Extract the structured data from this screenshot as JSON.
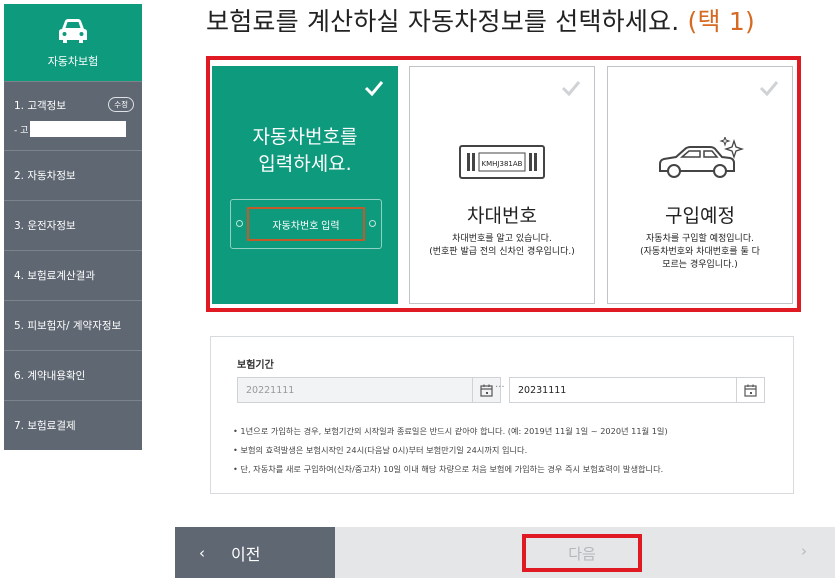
{
  "sidebar": {
    "head_label": "자동차보험",
    "items": [
      {
        "label": "1. 고객정보",
        "badge": "수정",
        "sub_prefix": "- 고"
      },
      {
        "label": "2. 자동차정보"
      },
      {
        "label": "3. 운전자정보"
      },
      {
        "label": "4. 보험료계산결과"
      },
      {
        "label": "5. 피보험자/ 계약자정보"
      },
      {
        "label": "6. 계약내용확인"
      },
      {
        "label": "7. 보험료결제"
      }
    ]
  },
  "main": {
    "title": "보험료를 계산하실 자동차정보를 선택하세요.",
    "title_hint": "(택 1)",
    "cards": [
      {
        "line1": "자동차번호를",
        "line2": "입력하세요.",
        "button": "자동차번호 입력"
      },
      {
        "plate": "KMHJ381AB",
        "name": "차대번호",
        "desc1": "차대번호를 알고 있습니다.",
        "desc2": "(번호판 발급 전의 신차인 경우입니다.)"
      },
      {
        "name": "구입예정",
        "desc1": "자동차를 구입할 예정입니다.",
        "desc2": "(자동차번호와 차대번호를 둘 다",
        "desc3": "모르는 경우입니다.)"
      }
    ],
    "period": {
      "label": "보험기간",
      "start": "20221111",
      "end": "20231111",
      "notes": [
        "• 1년으로 가입하는 경우, 보험기간의 시작일과 종료일은 반드시 같아야 합니다. (예: 2019년 11월 1일 ~ 2020년 11월 1일)",
        "• 보험의 효력발생은 보험시작인 24시(다음날 0시)부터 보험만기일 24시까지 입니다.",
        "• 단, 자동차를 새로 구입하여(신차/중고차) 10일 이내 해당 차량으로 처음 보험에 가입하는 경우 즉시 보험효력이 발생합니다."
      ]
    }
  },
  "footer": {
    "prev_label": "이전",
    "next_label": "다음"
  },
  "colors": {
    "green": "#0e9a7d",
    "sidebar": "#5f6772",
    "highlight": "#e01a22",
    "accent": "#d66a22"
  }
}
